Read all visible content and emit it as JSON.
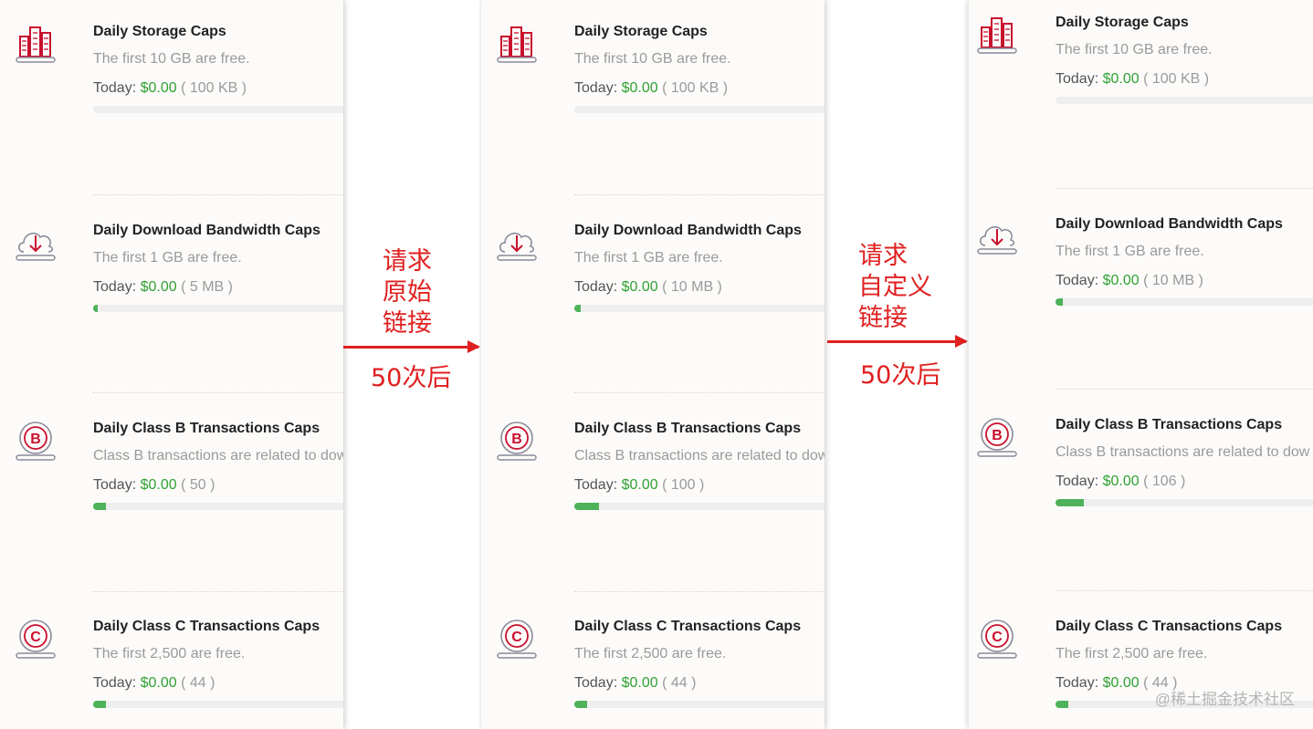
{
  "panels": [
    {
      "cards": [
        {
          "title": "Daily Storage Caps",
          "desc": "The first 10 GB are free.",
          "today_label": "Today:",
          "cost": "$0.00",
          "usage": "( 100 KB )",
          "progress": 0.0
        },
        {
          "title": "Daily Download Bandwidth Caps",
          "desc": "The first 1 GB are free.",
          "today_label": "Today:",
          "cost": "$0.00",
          "usage": "( 5 MB )",
          "progress": 0.01
        },
        {
          "title": "Daily Class B Transactions Caps",
          "desc": "Class B transactions are related to dow",
          "today_label": "Today:",
          "cost": "$0.00",
          "usage": "( 50 )",
          "progress": 0.05
        },
        {
          "title": "Daily Class C Transactions Caps",
          "desc": "The first 2,500 are free.",
          "today_label": "Today:",
          "cost": "$0.00",
          "usage": "( 44 )",
          "progress": 0.05
        }
      ]
    },
    {
      "cards": [
        {
          "title": "Daily Storage Caps",
          "desc": "The first 10 GB are free.",
          "today_label": "Today:",
          "cost": "$0.00",
          "usage": "( 100 KB )",
          "progress": 0.0
        },
        {
          "title": "Daily Download Bandwidth Caps",
          "desc": "The first 1 GB are free.",
          "today_label": "Today:",
          "cost": "$0.00",
          "usage": "( 10 MB )",
          "progress": 0.027
        },
        {
          "title": "Daily Class B Transactions Caps",
          "desc": "Class B transactions are related to dow",
          "today_label": "Today:",
          "cost": "$0.00",
          "usage": "( 100 )",
          "progress": 0.1
        },
        {
          "title": "Daily Class C Transactions Caps",
          "desc": "The first 2,500 are free.",
          "today_label": "Today:",
          "cost": "$0.00",
          "usage": "( 44 )",
          "progress": 0.05
        }
      ]
    },
    {
      "cards": [
        {
          "title": "Daily Storage Caps",
          "desc": "The first 10 GB are free.",
          "today_label": "Today:",
          "cost": "$0.00",
          "usage": "( 100 KB )",
          "progress": 0.0
        },
        {
          "title": "Daily Download Bandwidth Caps",
          "desc": "The first 1 GB are free.",
          "today_label": "Today:",
          "cost": "$0.00",
          "usage": "( 10 MB )",
          "progress": 0.03
        },
        {
          "title": "Daily Class B Transactions Caps",
          "desc": "Class B transactions are related to dow",
          "today_label": "Today:",
          "cost": "$0.00",
          "usage": "( 106 )",
          "progress": 0.11
        },
        {
          "title": "Daily Class C Transactions Caps",
          "desc": "The first 2,500 are free.",
          "today_label": "Today:",
          "cost": "$0.00",
          "usage": "( 44 )",
          "progress": 0.05
        }
      ]
    }
  ],
  "icons": [
    "storage-icon",
    "cloud-download-icon",
    "class-b-icon",
    "class-c-icon"
  ],
  "annotations": [
    {
      "lines": [
        "请求",
        "原始",
        "链接"
      ],
      "count": "50次后"
    },
    {
      "lines": [
        "请求",
        "自定义",
        "链接"
      ],
      "count": "50次后"
    }
  ],
  "watermark": "@稀土掘金技术社区",
  "colors": {
    "accent_red": "#e02020",
    "cost_green": "#2fa132",
    "bar_green": "#4db25a",
    "icon_red": "#c8102e"
  }
}
